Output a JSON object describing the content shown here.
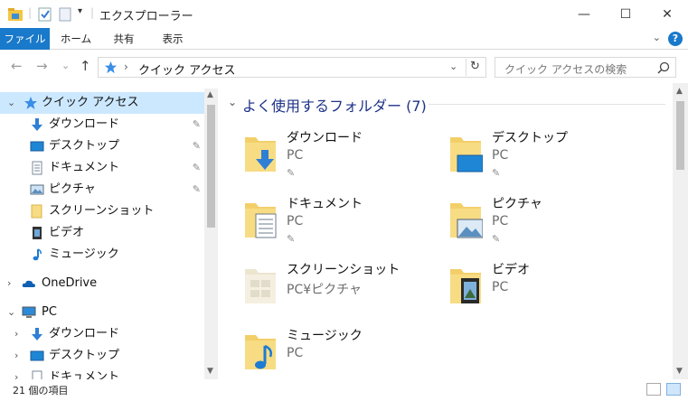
{
  "window": {
    "title": "エクスプローラー",
    "minimize": "—",
    "maximize": "☐",
    "close": "✕"
  },
  "ribbon": {
    "tabs": [
      "ファイル",
      "ホーム",
      "共有",
      "表示"
    ],
    "help": "?",
    "expand": "⌄"
  },
  "nav": {
    "back": "←",
    "forward": "→",
    "recent": "⌄",
    "up": "↑",
    "address": "クイック アクセス",
    "address_sep": "›",
    "dropdown": "⌄",
    "refresh": "↻",
    "search_placeholder": "クイック アクセスの検索"
  },
  "tree": [
    {
      "label": "クイック アクセス",
      "caret": "⌄",
      "icon": "star-icon",
      "selected": true,
      "level": 0,
      "pinned": false
    },
    {
      "label": "ダウンロード",
      "icon": "download-icon",
      "level": 1,
      "pinned": true
    },
    {
      "label": "デスクトップ",
      "icon": "desktop-icon",
      "level": 1,
      "pinned": true
    },
    {
      "label": "ドキュメント",
      "icon": "document-icon",
      "level": 1,
      "pinned": true
    },
    {
      "label": "ピクチャ",
      "icon": "picture-icon",
      "level": 1,
      "pinned": true
    },
    {
      "label": "スクリーンショット",
      "icon": "folder-icon",
      "level": 1,
      "pinned": false
    },
    {
      "label": "ビデオ",
      "icon": "video-icon",
      "level": 1,
      "pinned": false
    },
    {
      "label": "ミュージック",
      "icon": "music-icon",
      "level": 1,
      "pinned": false
    },
    {
      "label": "OneDrive",
      "caret": "›",
      "icon": "cloud-icon",
      "level": 0,
      "pinned": false
    },
    {
      "label": "PC",
      "caret": "⌄",
      "icon": "pc-icon",
      "level": 0,
      "pinned": false
    },
    {
      "label": "ダウンロード",
      "caret": "›",
      "icon": "download-icon",
      "level": 1,
      "pinned": false
    },
    {
      "label": "デスクトップ",
      "caret": "›",
      "icon": "desktop-icon",
      "level": 1,
      "pinned": false
    },
    {
      "label": "ドキュメント",
      "caret": "›",
      "icon": "document-icon",
      "level": 1,
      "pinned": false
    }
  ],
  "pin_glyph": "📌",
  "group": {
    "header": "よく使用するフォルダー (7)",
    "caret": "⌄"
  },
  "folders": [
    {
      "name": "ダウンロード",
      "location": "PC",
      "pinned": true,
      "icon": "download-folder-icon"
    },
    {
      "name": "デスクトップ",
      "location": "PC",
      "pinned": true,
      "icon": "desktop-folder-icon"
    },
    {
      "name": "ドキュメント",
      "location": "PC",
      "pinned": true,
      "icon": "document-folder-icon"
    },
    {
      "name": "ピクチャ",
      "location": "PC",
      "pinned": true,
      "icon": "picture-folder-icon"
    },
    {
      "name": "スクリーンショット",
      "location": "PC¥ピクチャ",
      "pinned": false,
      "icon": "screenshot-folder-icon"
    },
    {
      "name": "ビデオ",
      "location": "PC",
      "pinned": false,
      "icon": "video-folder-icon"
    },
    {
      "name": "ミュージック",
      "location": "PC",
      "pinned": false,
      "icon": "music-folder-icon"
    }
  ],
  "status": {
    "count": "21 個の項目"
  },
  "colors": {
    "accent": "#1979ca",
    "selection": "#cce8ff",
    "group_header": "#1e3287",
    "folder": "#f5d775"
  }
}
